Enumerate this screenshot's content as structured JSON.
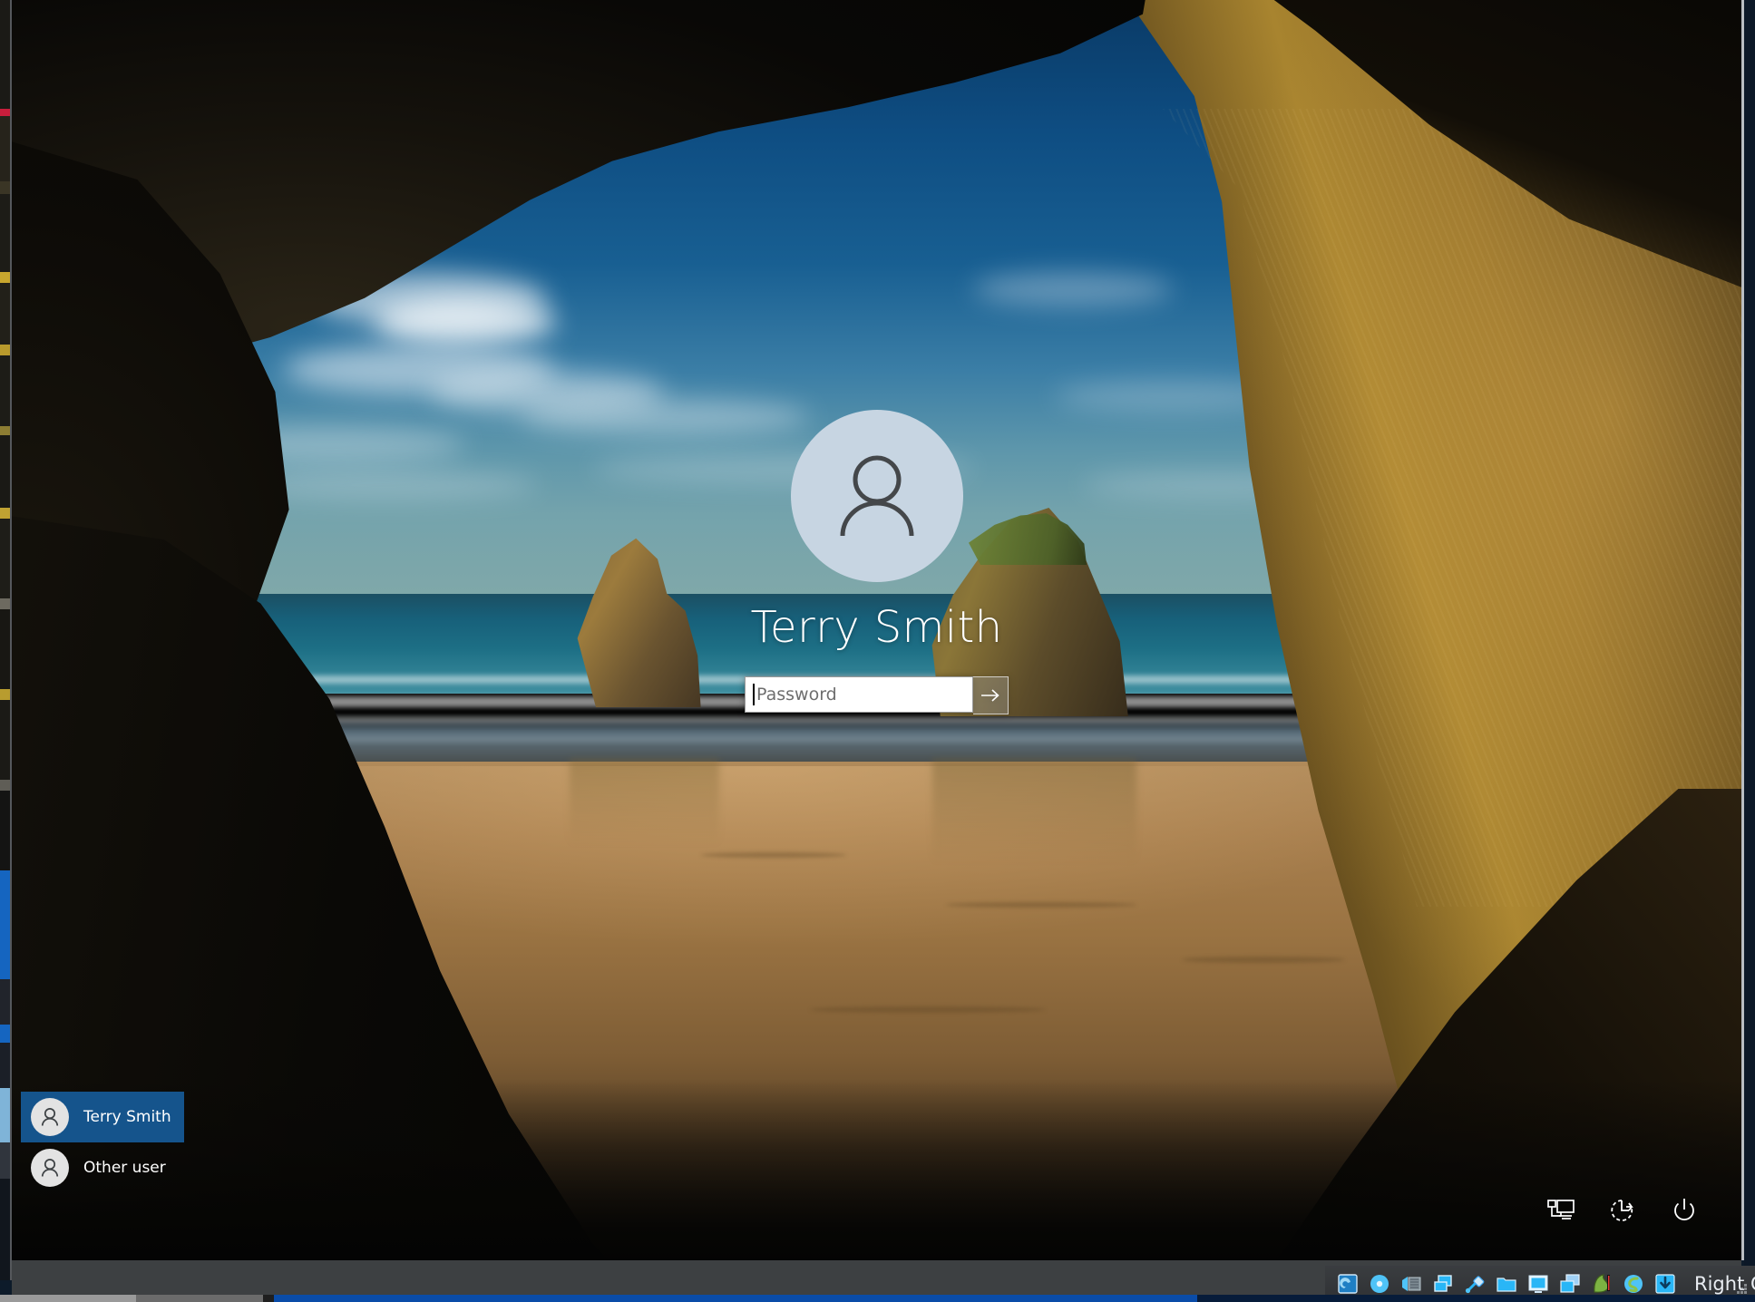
{
  "screen": {
    "type": "windows-lock-screen",
    "wallpaper_name": "wharariki-beach-cave"
  },
  "login": {
    "avatar_icon": "user-avatar-icon",
    "username": "Terry Smith",
    "password_placeholder": "Password",
    "password_value": "",
    "submit_icon": "arrow-right-icon"
  },
  "user_list": [
    {
      "label": "Terry Smith",
      "icon": "user-avatar-icon",
      "selected": true
    },
    {
      "label": "Other user",
      "icon": "user-avatar-icon",
      "selected": false
    }
  ],
  "system_icons": [
    {
      "name": "network-icon",
      "label": "Network"
    },
    {
      "name": "ease-of-access-icon",
      "label": "Ease of access"
    },
    {
      "name": "power-icon",
      "label": "Power"
    }
  ],
  "vm_status_bar": {
    "host_key": "Right Ctrl",
    "icons": [
      {
        "name": "hard-disk-icon",
        "color": "#3fa9f5"
      },
      {
        "name": "optical-disk-icon",
        "color": "#4fc3f7"
      },
      {
        "name": "floppy-disk-icon",
        "color": "#90a4ae"
      },
      {
        "name": "network-adapter-icon",
        "color": "#29b6f6"
      },
      {
        "name": "usb-icon",
        "color": "#4fc3f7"
      },
      {
        "name": "shared-folder-icon",
        "color": "#29b6f6"
      },
      {
        "name": "display-icon",
        "color": "#4fc3f7"
      },
      {
        "name": "recording-icon",
        "color": "#64b5f6"
      },
      {
        "name": "mouse-integration-icon",
        "color": "#7cb342"
      },
      {
        "name": "keyboard-icon",
        "color": "#4fc3f7"
      },
      {
        "name": "host-key-icon",
        "color": "#29b6f6"
      }
    ],
    "resize_grip": "resize-grip-icon"
  },
  "colors": {
    "accent_blue": "#15548c",
    "avatar_bg": "#c7d5e2",
    "avatar_fg": "#44474a",
    "sky_top": "#0a3a66",
    "sand": "#a87f4e",
    "vm_chrome": "#3d4042"
  }
}
